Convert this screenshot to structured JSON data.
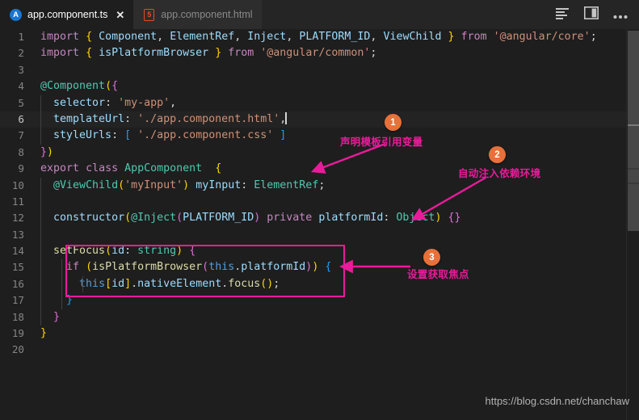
{
  "window": {
    "background": "#1e1e1e",
    "tabbar_background": "#252526"
  },
  "tabs": [
    {
      "label": "app.component.ts",
      "icon": "angular-icon",
      "icon_glyph": "A",
      "active": true,
      "close_glyph": "✕"
    },
    {
      "label": "app.component.html",
      "icon": "html5-icon",
      "icon_glyph": "5",
      "active": false,
      "close_glyph": ""
    }
  ],
  "tabbar_actions": [
    {
      "name": "open-changes-icon",
      "title": "Open Changes"
    },
    {
      "name": "split-editor-icon",
      "title": "Split Editor Right"
    },
    {
      "name": "more-actions-icon",
      "title": "More Actions..."
    }
  ],
  "editor": {
    "language": "typescript",
    "current_line": 6,
    "total_lines": 20,
    "lines": [
      {
        "n": 1,
        "text": "import { Component, ElementRef, Inject, PLATFORM_ID, ViewChild } from '@angular/core';"
      },
      {
        "n": 2,
        "text": "import { isPlatformBrowser } from '@angular/common';"
      },
      {
        "n": 3,
        "text": ""
      },
      {
        "n": 4,
        "text": "@Component({"
      },
      {
        "n": 5,
        "text": "  selector: 'my-app',"
      },
      {
        "n": 6,
        "text": "  templateUrl: './app.component.html',"
      },
      {
        "n": 7,
        "text": "  styleUrls: [ './app.component.css' ]"
      },
      {
        "n": 8,
        "text": "})"
      },
      {
        "n": 9,
        "text": "export class AppComponent  {"
      },
      {
        "n": 10,
        "text": "  @ViewChild('myInput') myInput: ElementRef;"
      },
      {
        "n": 11,
        "text": ""
      },
      {
        "n": 12,
        "text": "  constructor(@Inject(PLATFORM_ID) private platformId: Object) {}"
      },
      {
        "n": 13,
        "text": ""
      },
      {
        "n": 14,
        "text": "  setFocus(id: string) {"
      },
      {
        "n": 15,
        "text": "    if (isPlatformBrowser(this.platformId)) {"
      },
      {
        "n": 16,
        "text": "      this[id].nativeElement.focus();"
      },
      {
        "n": 17,
        "text": "    }"
      },
      {
        "n": 18,
        "text": "  }"
      },
      {
        "n": 19,
        "text": "}"
      },
      {
        "n": 20,
        "text": ""
      }
    ]
  },
  "annotations": {
    "accent_color": "#ea1b9b",
    "badge_color": "#e8703a",
    "items": [
      {
        "number": "1",
        "text": "声明模板引用变量",
        "target_line": 10
      },
      {
        "number": "2",
        "text": "自动注入依赖环境",
        "target_line": 12
      },
      {
        "number": "3",
        "text": "设置获取焦点",
        "target_line": 15
      }
    ]
  },
  "watermark": {
    "text": "https://blog.csdn.net/chanchaw"
  }
}
